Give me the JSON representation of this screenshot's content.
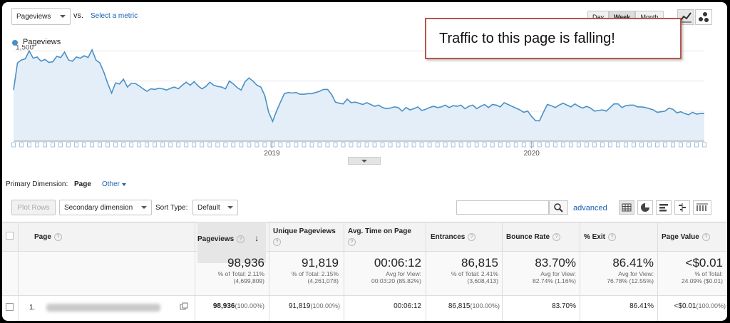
{
  "metric_select": {
    "value": "Pageviews"
  },
  "vs_label": "vs.",
  "select_metric": "Select a metric",
  "period_buttons": [
    "Day",
    "Week",
    "Month"
  ],
  "legend": {
    "label": "Pageviews",
    "color": "#4a90c6"
  },
  "annotation": "Traffic to this page is falling!",
  "chart_data": {
    "type": "area",
    "ylabel_ticks": [
      "1,500",
      "1,000",
      "500"
    ],
    "yticks": [
      1500,
      1000,
      500
    ],
    "ylim": [
      0,
      1600
    ],
    "x_ticks": [
      "2019",
      "2020"
    ],
    "series": [
      {
        "values": [
          850,
          1300,
          1350,
          1370,
          1500,
          1380,
          1400,
          1330,
          1360,
          1310,
          1320,
          1410,
          1390,
          1480,
          1350,
          1330,
          1400,
          1380,
          1420,
          1390,
          1520,
          1350,
          1300,
          1150,
          960,
          800,
          970,
          950,
          1030,
          900,
          960,
          960,
          920,
          870,
          830,
          870,
          860,
          880,
          870,
          850,
          880,
          900,
          870,
          930,
          980,
          930,
          990,
          920,
          870,
          910,
          980,
          930,
          910,
          900,
          870,
          1000,
          950,
          890,
          850,
          990,
          1050,
          1000,
          930,
          900,
          760,
          480,
          330,
          500,
          650,
          790,
          810,
          800,
          810,
          780,
          780,
          790,
          790,
          810,
          830,
          860,
          860,
          780,
          650,
          630,
          620,
          700,
          640,
          650,
          630,
          610,
          640,
          610,
          580,
          600,
          560,
          540,
          550,
          570,
          560,
          500,
          560,
          520,
          540,
          570,
          510,
          530,
          560,
          580,
          560,
          570,
          600,
          560,
          590,
          580,
          600,
          540,
          580,
          600,
          540,
          580,
          610,
          560,
          610,
          600,
          570,
          640,
          610,
          580,
          550,
          520,
          480,
          500,
          410,
          340,
          340,
          480,
          610,
          590,
          560,
          600,
          630,
          600,
          570,
          620,
          580,
          550,
          580,
          550,
          500,
          510,
          520,
          500,
          560,
          620,
          620,
          560,
          590,
          600,
          600,
          570,
          570,
          560,
          540,
          520,
          480,
          490,
          500,
          550,
          530,
          470,
          490,
          460,
          440,
          480,
          450,
          460,
          460
        ],
        "color": "#4a90c6"
      }
    ]
  },
  "dimension": {
    "label": "Primary Dimension:",
    "active": "Page",
    "other": "Other"
  },
  "toolbar": {
    "plot_rows": "Plot Rows",
    "secondary_dimension": "Secondary dimension",
    "sort_type_label": "Sort Type:",
    "sort_type_value": "Default",
    "search_placeholder": "",
    "advanced": "advanced"
  },
  "table": {
    "headers": [
      "Page",
      "Pageviews",
      "Unique Pageviews",
      "Avg. Time on Page",
      "Entrances",
      "Bounce Rate",
      "% Exit",
      "Page Value"
    ],
    "totals": [
      {
        "value": "98,936",
        "sub1": "% of Total: 2.11%",
        "sub2": "(4,699,809)"
      },
      {
        "value": "91,819",
        "sub1": "% of Total: 2.15%",
        "sub2": "(4,261,078)"
      },
      {
        "value": "00:06:12",
        "sub1": "Avg for View:",
        "sub2": "00:03:20 (85.82%)"
      },
      {
        "value": "86,815",
        "sub1": "% of Total: 2.41%",
        "sub2": "(3,608,413)"
      },
      {
        "value": "83.70%",
        "sub1": "Avg for View:",
        "sub2": "82.74% (1.16%)"
      },
      {
        "value": "86.41%",
        "sub1": "Avg for View:",
        "sub2": "76.78% (12.55%)"
      },
      {
        "value": "<$0.01",
        "sub1": "% of Total:",
        "sub2": "24.09% ($0.01)"
      }
    ],
    "row": {
      "index": "1.",
      "pageviews": "98,936",
      "pageviews_pct": "(100.00%)",
      "unique": "91,819",
      "unique_pct": "(100.00%)",
      "avg_time": "00:06:12",
      "entrances": "86,815",
      "entrances_pct": "(100.00%)",
      "bounce": "83.70%",
      "exit": "86.41%",
      "value": "<$0.01",
      "value_pct": "(100.00%)"
    }
  }
}
